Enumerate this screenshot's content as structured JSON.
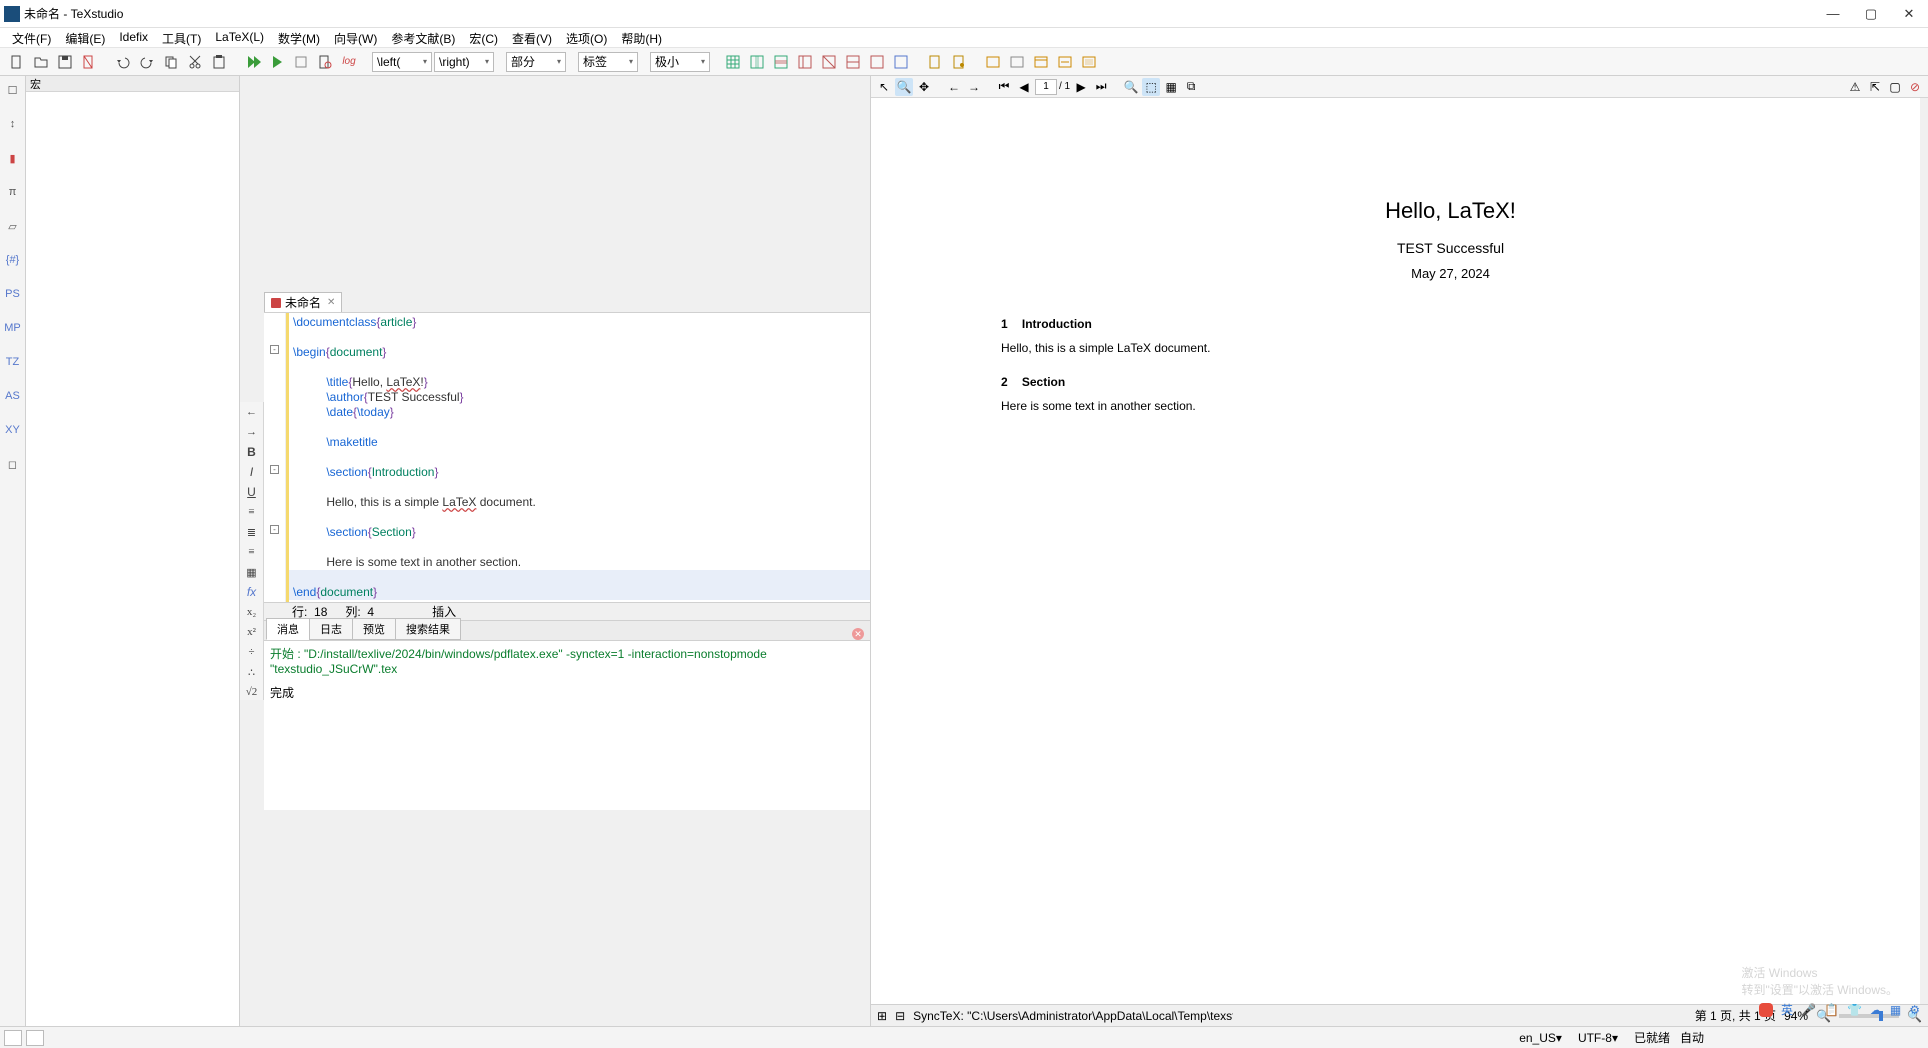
{
  "window": {
    "title": "未命名 - TeXstudio"
  },
  "menu": [
    "文件(F)",
    "编辑(E)",
    "Idefix",
    "工具(T)",
    "LaTeX(L)",
    "数学(M)",
    "向导(W)",
    "参考文献(B)",
    "宏(C)",
    "查看(V)",
    "选项(O)",
    "帮助(H)"
  ],
  "combos": {
    "left": "\\left(",
    "right": "\\right)",
    "section": "部分",
    "label": "标签",
    "tiny": "极小"
  },
  "sidebar": {
    "header": "宏",
    "items": [
      "B",
      "I",
      "U",
      "≡",
      "≣",
      "≡",
      "▦",
      "fx",
      "x₂",
      "x²",
      "÷",
      "∴",
      "√2"
    ]
  },
  "leftbar": [
    "☐",
    "↕",
    "▮",
    "π",
    "▱",
    "{#}",
    "PS",
    "MP",
    "TZ",
    "AS",
    "XY",
    "◻"
  ],
  "tab": {
    "name": "未命名"
  },
  "code": [
    {
      "indent": 0,
      "cmd": "\\documentclass",
      "arg": "article"
    },
    {
      "blank": true
    },
    {
      "indent": 0,
      "cmd": "\\begin",
      "arg": "document",
      "fold": true
    },
    {
      "blank": true
    },
    {
      "indent": 2,
      "cmd": "\\title",
      "raw": "Hello, ",
      "err": "LaTeX",
      "raw2": "!"
    },
    {
      "indent": 2,
      "cmd": "\\author",
      "raw": "TEST Successful"
    },
    {
      "indent": 2,
      "cmd": "\\date",
      "inner": "\\today"
    },
    {
      "blank": true
    },
    {
      "indent": 2,
      "cmd": "\\maketitle",
      "bare": true
    },
    {
      "blank": true
    },
    {
      "indent": 2,
      "cmd": "\\section",
      "arg": "Introduction",
      "fold": true
    },
    {
      "blank": true
    },
    {
      "indent": 2,
      "text": "Hello, this is a simple ",
      "err": "LaTeX",
      "text2": " document."
    },
    {
      "blank": true
    },
    {
      "indent": 2,
      "cmd": "\\section",
      "arg": "Section",
      "fold": true
    },
    {
      "blank": true
    },
    {
      "indent": 2,
      "text": "Here is some text in another section."
    },
    {
      "blank": true,
      "hl": true
    },
    {
      "indent": 0,
      "cmd": "\\end",
      "arg": "document",
      "hl": true
    }
  ],
  "estatus": {
    "line_lbl": "行:",
    "line": "18",
    "col_lbl": "列:",
    "col": "4",
    "mode": "插入"
  },
  "btabs": [
    "消息",
    "日志",
    "预览",
    "搜索结果"
  ],
  "msgs": {
    "start": "开始 : \"D:/install/texlive/2024/bin/windows/pdflatex.exe\" -synctex=1 -interaction=nonstopmode \"texstudio_JSuCrW\".tex",
    "done": "完成"
  },
  "preview": {
    "toolbar": {
      "page": "1",
      "total_sep": "/ 1"
    },
    "pdf": {
      "title": "Hello, LaTeX!",
      "author": "TEST Successful",
      "date": "May 27, 2024",
      "sec1_num": "1",
      "sec1": "Introduction",
      "para1": "Hello, this is a simple LaTeX document.",
      "sec2_num": "2",
      "sec2": "Section",
      "para2": "Here is some text in another section."
    },
    "status": {
      "synctex": "SyncTeX: \"C:\\Users\\Administrator\\AppData\\Local\\Temp\\texstudio_JSuCrW",
      "pages": "第 1 页, 共 1 页",
      "zoom": "94%"
    }
  },
  "footer": {
    "lang": "en_US",
    "enc": "UTF-8",
    "state": "已就绪",
    "auto": "自动"
  },
  "watermark": {
    "l1": "激活 Windows",
    "l2": "转到\"设置\"以激活 Windows。"
  },
  "tray": {
    "ime": "英"
  }
}
